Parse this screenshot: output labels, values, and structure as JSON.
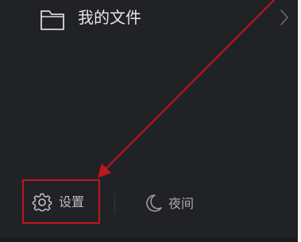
{
  "menu": {
    "my_files_label": "我的文件",
    "icons": {
      "folder": "folder-icon",
      "chevron": "chevron-right-icon"
    }
  },
  "footer": {
    "settings_label": "设置",
    "night_label": "夜间",
    "icons": {
      "settings": "gear-icon",
      "night": "moon-icon"
    }
  },
  "annotation": {
    "highlight_color": "#c0161c",
    "arrow_color": "#c0161c"
  },
  "colors": {
    "panel_background": "#212226",
    "primary_text": "#e6e6e6",
    "secondary_text": "#bdbdbd"
  }
}
